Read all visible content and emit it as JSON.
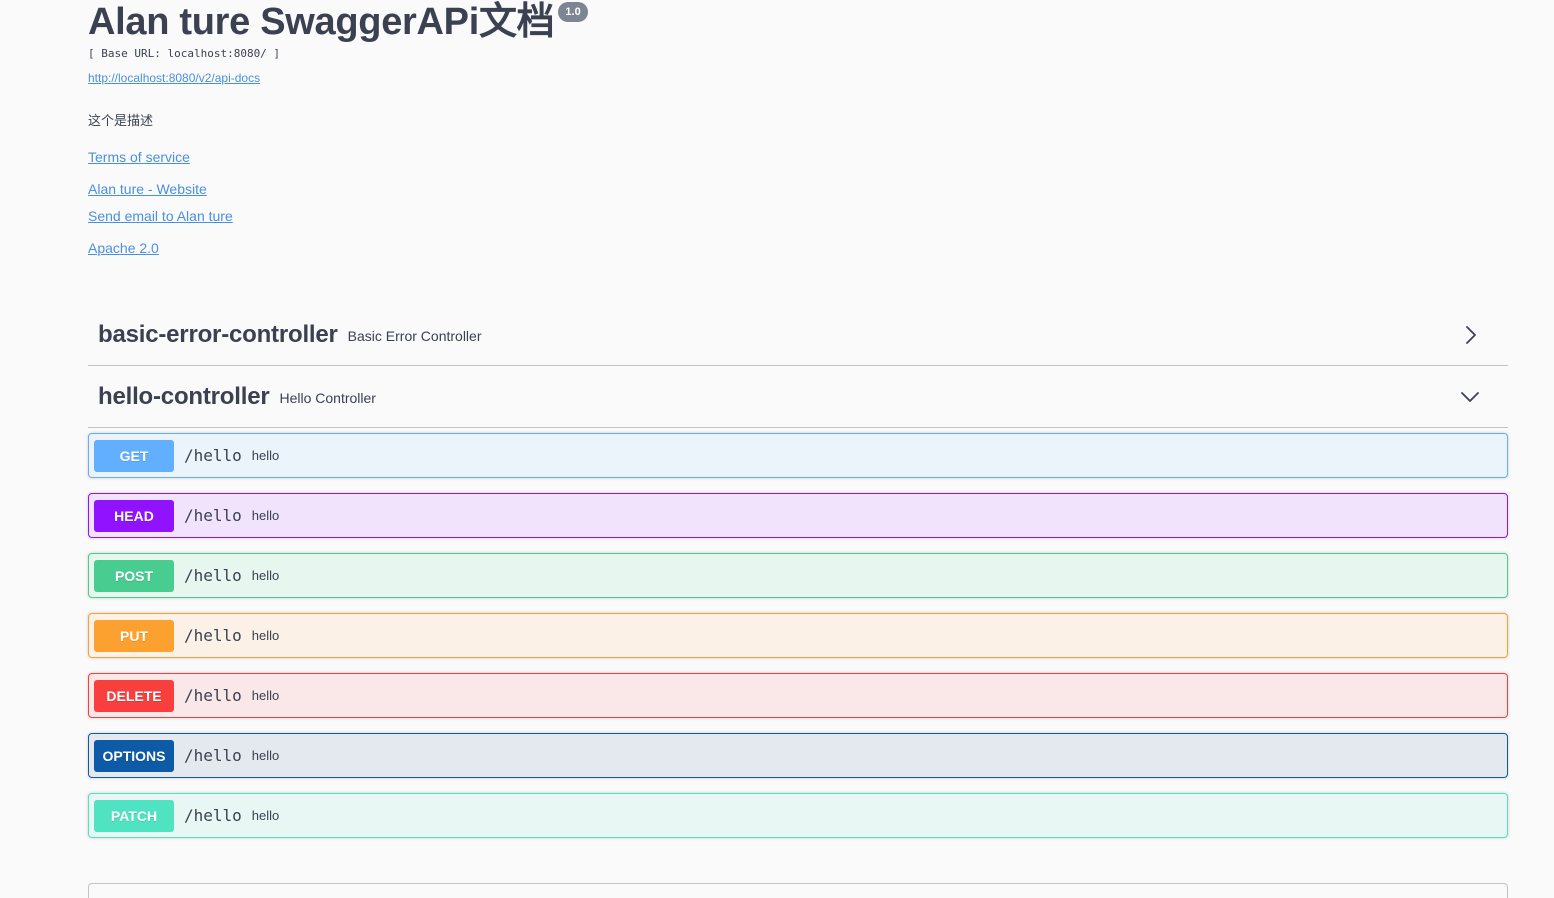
{
  "info": {
    "title": "Alan ture SwaggerAPi文档",
    "version": "1.0",
    "base_url": "[ Base URL: localhost:8080/ ]",
    "api_docs_link": "http://localhost:8080/v2/api-docs",
    "description": "这个是描述",
    "terms_link": "Terms of service",
    "website_link": "Alan ture - Website",
    "email_link": "Send email to Alan ture",
    "license_link": "Apache 2.0"
  },
  "tags": [
    {
      "name": "basic-error-controller",
      "description": "Basic Error Controller",
      "state": "collapsed"
    },
    {
      "name": "hello-controller",
      "description": "Hello Controller",
      "state": "expanded"
    }
  ],
  "operations": [
    {
      "method": "GET",
      "path": "/hello",
      "summary": "hello",
      "color": "#61affe",
      "bg": "#ebf3fb",
      "border": "#61affe"
    },
    {
      "method": "HEAD",
      "path": "/hello",
      "summary": "hello",
      "color": "#9012fe",
      "bg": "#f0e3fb",
      "border": "#9012fe"
    },
    {
      "method": "POST",
      "path": "/hello",
      "summary": "hello",
      "color": "#49cc90",
      "bg": "#e8f6f0",
      "border": "#49cc90"
    },
    {
      "method": "PUT",
      "path": "/hello",
      "summary": "hello",
      "color": "#fca130",
      "bg": "#fbf1e6",
      "border": "#fca130"
    },
    {
      "method": "DELETE",
      "path": "/hello",
      "summary": "hello",
      "color": "#f93e3e",
      "bg": "#fae7e7",
      "border": "#f93e3e"
    },
    {
      "method": "OPTIONS",
      "path": "/hello",
      "summary": "hello",
      "color": "#0d5aa7",
      "bg": "#e4e9f0",
      "border": "#0d5aa7"
    },
    {
      "method": "PATCH",
      "path": "/hello",
      "summary": "hello",
      "color": "#50e3c2",
      "bg": "#e9f7f4",
      "border": "#50e3c2"
    }
  ]
}
